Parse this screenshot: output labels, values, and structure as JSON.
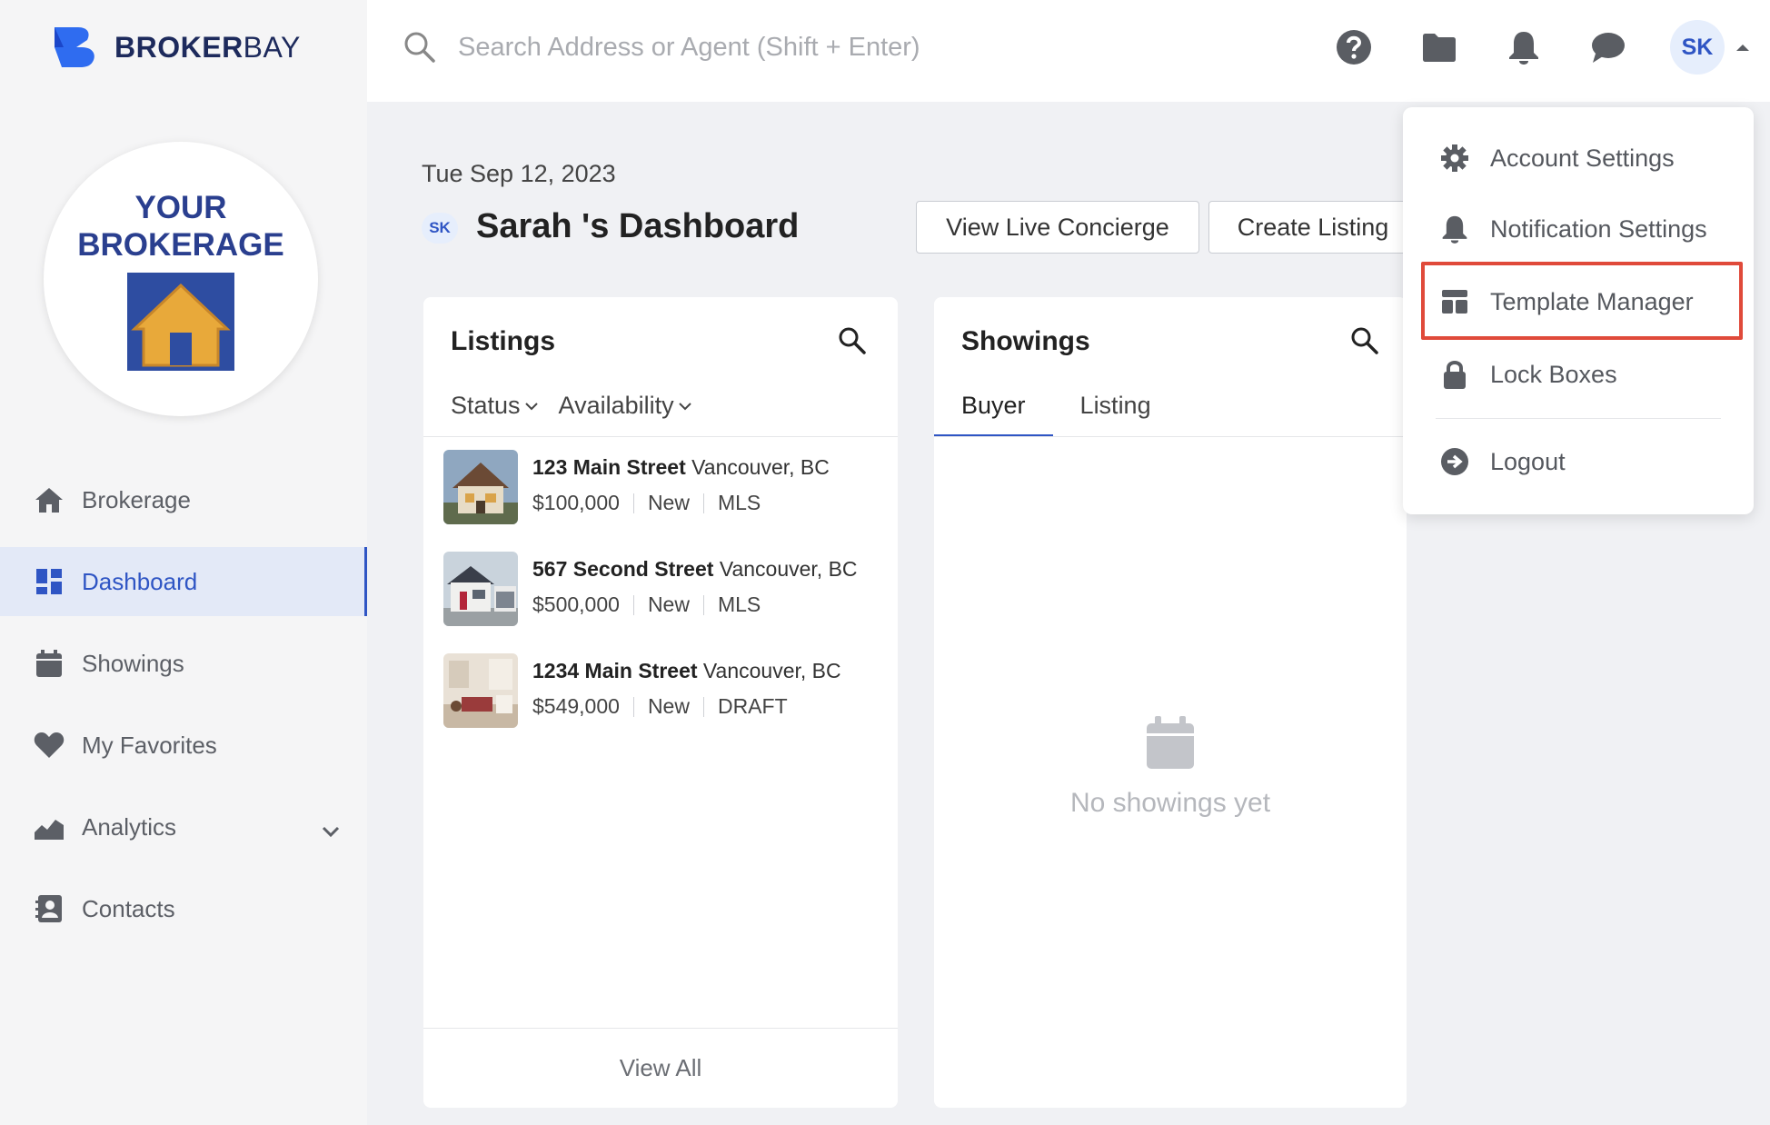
{
  "app": {
    "brand_bold": "BROKER",
    "brand_light": "BAY"
  },
  "brokerage": {
    "line1": "YOUR",
    "line2": "BROKERAGE"
  },
  "sidebar": {
    "items": [
      {
        "label": "Brokerage",
        "icon": "home-icon"
      },
      {
        "label": "Dashboard",
        "icon": "dashboard-icon",
        "active": true
      },
      {
        "label": "Showings",
        "icon": "calendar-icon"
      },
      {
        "label": "My Favorites",
        "icon": "heart-icon"
      },
      {
        "label": "Analytics",
        "icon": "chart-icon",
        "expandable": true
      },
      {
        "label": "Contacts",
        "icon": "contacts-icon"
      }
    ]
  },
  "search": {
    "placeholder": "Search Address or Agent (Shift + Enter)"
  },
  "topbar": {
    "icons": [
      "help-icon",
      "folder-icon",
      "bell-icon",
      "chat-icon"
    ],
    "avatar_initials": "SK"
  },
  "dashboard": {
    "date": "Tue Sep 12, 2023",
    "badge": "SK",
    "title": "Sarah 's Dashboard",
    "buttons": {
      "concierge": "View Live Concierge",
      "create_listing": "Create Listing"
    }
  },
  "listings_card": {
    "title": "Listings",
    "filters": {
      "status": "Status",
      "availability": "Availability"
    },
    "items": [
      {
        "street": "123 Main Street",
        "city": "Vancouver, BC",
        "price": "$100,000",
        "status": "New",
        "source": "MLS"
      },
      {
        "street": "567 Second Street",
        "city": "Vancouver, BC",
        "price": "$500,000",
        "status": "New",
        "source": "MLS"
      },
      {
        "street": "1234 Main Street",
        "city": "Vancouver, BC",
        "price": "$549,000",
        "status": "New",
        "source": "DRAFT"
      }
    ],
    "view_all": "View All"
  },
  "showings_card": {
    "title": "Showings",
    "tabs": {
      "buyer": "Buyer",
      "listing": "Listing"
    },
    "empty_text": "No showings yet"
  },
  "user_menu": {
    "items": [
      {
        "label": "Account Settings",
        "icon": "gear-icon"
      },
      {
        "label": "Notification Settings",
        "icon": "bell-icon"
      },
      {
        "label": "Template Manager",
        "icon": "template-icon",
        "highlighted": true
      },
      {
        "label": "Lock Boxes",
        "icon": "lock-icon"
      },
      {
        "label": "Logout",
        "icon": "logout-icon"
      }
    ]
  },
  "colors": {
    "accent": "#2f55c4",
    "highlight_border": "#e04a3a",
    "brand_navy": "#1d2a5c"
  }
}
